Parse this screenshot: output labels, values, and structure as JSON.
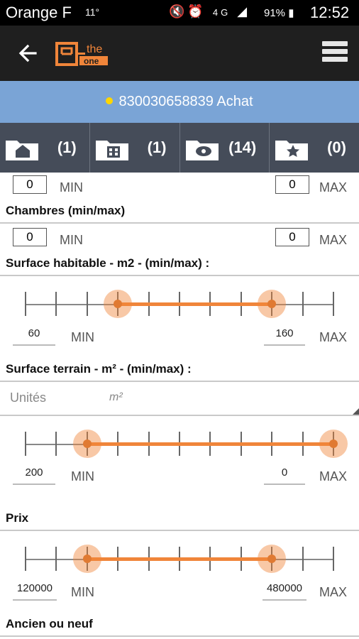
{
  "status_bar": {
    "carrier": "Orange F",
    "temperature": "11°",
    "signal": "4G",
    "battery": "91%",
    "time": "12:52"
  },
  "app_bar": {
    "back_icon": "arrow-left-icon",
    "logo_text": "e-the one",
    "menu_icon": "hamburger-icon"
  },
  "banner": {
    "text": "830030658839 Achat",
    "dot_color": "#ffd600"
  },
  "tabs": [
    {
      "icon": "folder-house-icon",
      "count": "(1)"
    },
    {
      "icon": "folder-building-icon",
      "count": "(1)"
    },
    {
      "icon": "folder-eye-icon",
      "count": "(14)"
    },
    {
      "icon": "folder-star-icon",
      "count": "(0)"
    }
  ],
  "rows": {
    "top": {
      "min_value": "0",
      "min_label": "MIN",
      "max_value": "0",
      "max_label": "MAX"
    },
    "chambres": {
      "title": "Chambres (min/max)",
      "min_value": "0",
      "min_label": "MIN",
      "max_value": "0",
      "max_label": "MAX"
    }
  },
  "surface_habitable": {
    "title": "Surface habitable - m2 - (min/max) :",
    "min_value": "60",
    "min_label": "MIN",
    "max_value": "160",
    "max_label": "MAX",
    "low_position": 0.3,
    "high_position": 0.8
  },
  "surface_terrain": {
    "title": "Surface terrain - m² - (min/max) :",
    "units_label": "Unités",
    "units_value": "m²",
    "min_value": "200",
    "min_label": "MIN",
    "max_value": "0",
    "max_label": "MAX",
    "low_position": 0.2,
    "high_position": 1.0
  },
  "prix": {
    "title": "Prix",
    "min_value": "120000",
    "min_label": "MIN",
    "max_value": "480000",
    "max_label": "MAX",
    "low_position": 0.2,
    "high_position": 0.8
  },
  "ancien": {
    "title": "Ancien ou neuf"
  },
  "colors": {
    "accent": "#f0853a",
    "banner": "#7aa4d6",
    "tabs": "#454c59",
    "appbar": "#1f1f1f"
  }
}
